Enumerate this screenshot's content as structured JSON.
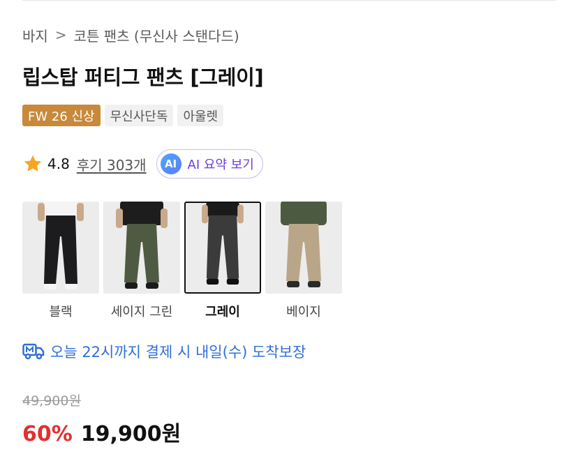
{
  "breadcrumb": {
    "category": "바지",
    "separator": ">",
    "subcategory": "코튼 팬츠 (무신사 스탠다드)"
  },
  "product": {
    "title": "립스탑 퍼티그 팬츠 [그레이]"
  },
  "badges": [
    {
      "label": "FW 26 신상",
      "style": "highlight",
      "color": "#c8893a"
    },
    {
      "label": "무신사단독",
      "style": "plain"
    },
    {
      "label": "아울렛",
      "style": "plain"
    }
  ],
  "rating": {
    "icon": "star-icon",
    "value": "4.8",
    "reviews_label": "후기 303개"
  },
  "ai_summary": {
    "icon_text": "AI",
    "label": "AI 요약 보기"
  },
  "colors": [
    {
      "label": "블랙",
      "selected": false,
      "pant_color": "#1c1c1e",
      "top_color": "#f4f4f4"
    },
    {
      "label": "세이지 그린",
      "selected": false,
      "pant_color": "#4f5a43",
      "top_color": "#1d1d1d"
    },
    {
      "label": "그레이",
      "selected": true,
      "pant_color": "#3a3b3a",
      "top_color": "#1a1a1a"
    },
    {
      "label": "베이지",
      "selected": false,
      "pant_color": "#b9a688",
      "top_color": "#4c5a42"
    }
  ],
  "delivery": {
    "icon": "delivery-truck-icon",
    "text": "오늘 22시까지 결제 시 내일(수) 도착보장"
  },
  "price": {
    "original": "49,900원",
    "discount": "60%",
    "current": "19,900원"
  },
  "theme": {
    "discount_color": "#e22f2f",
    "delivery_color": "#2f6fd8",
    "ai_color": "#6b3fd6"
  }
}
